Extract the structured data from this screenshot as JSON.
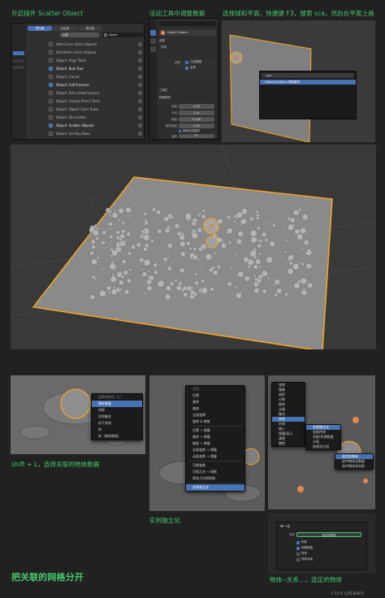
{
  "captions": {
    "enable_addon": "开启插件 Scatter Object",
    "active_tool": "活动工具中调整数据",
    "select_sphere": "选择球和平面，快捷键 F3，搜索 sca，然后在平面上画",
    "shift_l": "shift + L，选择关联的物体数据",
    "make_single": "实例独立化",
    "select_linked": "物体--关系...，选定的物体",
    "separate_mesh": "把关联的网格分开",
    "watermark": "CSDN @数美幽灵"
  },
  "addons": {
    "tabs": [
      "官方版",
      "社区版",
      "测试版"
    ],
    "filter": "全部",
    "search": "object",
    "items": [
      {
        "label": "Add Curve: Extra Objects",
        "enabled": false
      },
      {
        "label": "Add Mesh: Extra Objects",
        "enabled": false
      },
      {
        "label": "Object: Align Tools",
        "enabled": false
      },
      {
        "label": "Object: Bool Tool",
        "enabled": true
      },
      {
        "label": "Object: Carver",
        "enabled": false
      },
      {
        "label": "Object: Cell Fracture",
        "enabled": true
      },
      {
        "label": "Object: Edit Linked Library",
        "enabled": false
      },
      {
        "label": "Object: Grease Pencil Tools",
        "enabled": false
      },
      {
        "label": "Object: Object Color Rules",
        "enabled": false
      },
      {
        "label": "Object: Skin Editor",
        "enabled": false
      },
      {
        "label": "Object: Scatter Objects",
        "enabled": true
      },
      {
        "label": "Object: Set Key Base",
        "enabled": false
      }
    ]
  },
  "tool_panel": {
    "tool_name": "Object Scatter",
    "section_options": "选项",
    "section_mirror": "镜像",
    "section_scatter": "工具栏",
    "section_settings": "物体散布",
    "toggles": [
      {
        "label": "几何数据",
        "value": true
      },
      {
        "label": "名称",
        "value": true
      }
    ],
    "fields": [
      {
        "label": "密度",
        "value": "4.00"
      },
      {
        "label": "半径",
        "value": "1 m"
      },
      {
        "label": "缩放",
        "value": "0.200"
      },
      {
        "label": "随机缩放",
        "value": "0.50"
      }
    ],
    "use_normal": "使用法线旋转",
    "rotation_label": "旋转",
    "rotation_value": "0°",
    "random_rot_label": "随机旋转",
    "random_rot_value": "0°",
    "seed_label": "随机种子",
    "seed_value": "0"
  },
  "search_popup": {
    "query": "sca",
    "result": "Object Scatter ▸ 物体散布"
  },
  "select_linked_menu": {
    "title": "选择关联项（L）",
    "items": [
      "物体数据",
      "材质",
      "实例集合",
      "粒子系统",
      "库",
      "库（物体数据）"
    ],
    "selected": 0
  },
  "apply_menu": {
    "title": "应用",
    "groups": [
      [
        "位置",
        "旋转",
        "缩放",
        "全部变换",
        "旋转 & 缩放"
      ],
      [
        "位置 → 增量",
        "旋转 → 增量",
        "缩放 → 增量",
        "全部变换 → 增量",
        "动画变换 → 增量"
      ],
      [
        "可视变换",
        "可视几何 → 网格",
        "视觉几何到网格"
      ],
      [
        "实例独立化"
      ]
    ],
    "selected": "实例独立化"
  },
  "relations_menu": {
    "left": [
      "变换",
      "镜像",
      "吸附",
      "对称",
      "物体",
      "父级",
      "集合",
      "关系",
      "约束",
      "输入",
      "隐藏/显示",
      "清理",
      "删除"
    ],
    "sub": [
      "实例独立化",
      "变换传递",
      "关联/传递数据",
      "分离",
      "按类型分组"
    ],
    "deep": [
      "选定的物体",
      "选中物体及数据",
      "选中物体及材质"
    ],
    "selected": "选定的物体"
  },
  "single_user": {
    "title": "单一化",
    "type_label": "类型",
    "type_value": "选定的物体",
    "options": [
      {
        "label": "物体",
        "value": true
      },
      {
        "label": "网格数据",
        "value": true
      },
      {
        "label": "材质",
        "value": false
      },
      {
        "label": "物体动画",
        "value": false
      }
    ]
  },
  "colors": {
    "accent": "#47c96e",
    "select_blue": "#4772b3",
    "outline_orange": "#f5a623",
    "bg": "#212121"
  }
}
